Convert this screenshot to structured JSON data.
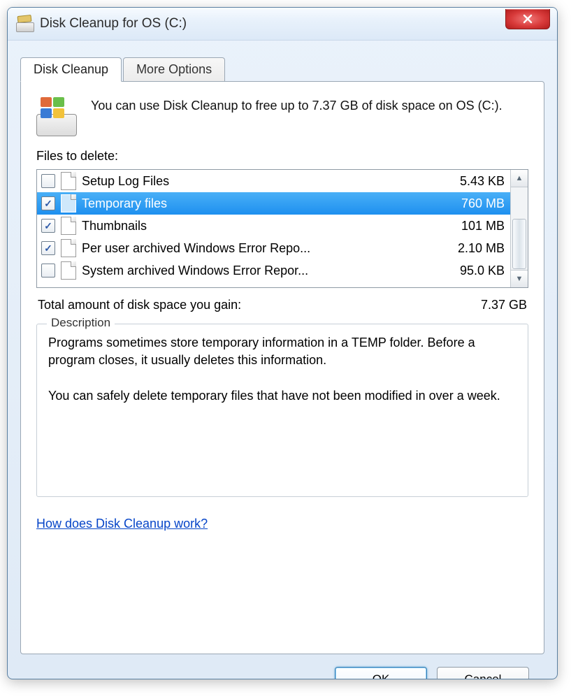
{
  "window": {
    "title": "Disk Cleanup for OS (C:)"
  },
  "tabs": {
    "cleanup": "Disk Cleanup",
    "more": "More Options"
  },
  "intro": "You can use Disk Cleanup to free up to 7.37 GB of disk space on OS (C:).",
  "files_label": "Files to delete:",
  "files": [
    {
      "name": "Setup Log Files",
      "size": "5.43 KB",
      "checked": false,
      "selected": false
    },
    {
      "name": "Temporary files",
      "size": "760 MB",
      "checked": true,
      "selected": true
    },
    {
      "name": "Thumbnails",
      "size": "101 MB",
      "checked": true,
      "selected": false
    },
    {
      "name": "Per user archived Windows Error Repo...",
      "size": "2.10 MB",
      "checked": true,
      "selected": false
    },
    {
      "name": "System archived Windows Error Repor...",
      "size": "95.0 KB",
      "checked": false,
      "selected": false
    }
  ],
  "total": {
    "label": "Total amount of disk space you gain:",
    "value": "7.37 GB"
  },
  "description": {
    "legend": "Description",
    "body": "Programs sometimes store temporary information in a TEMP folder. Before a program closes, it usually deletes this information.\n\nYou can safely delete temporary files that have not been modified in over a week."
  },
  "help_link": "How does Disk Cleanup work?",
  "buttons": {
    "ok": "OK",
    "cancel": "Cancel"
  }
}
